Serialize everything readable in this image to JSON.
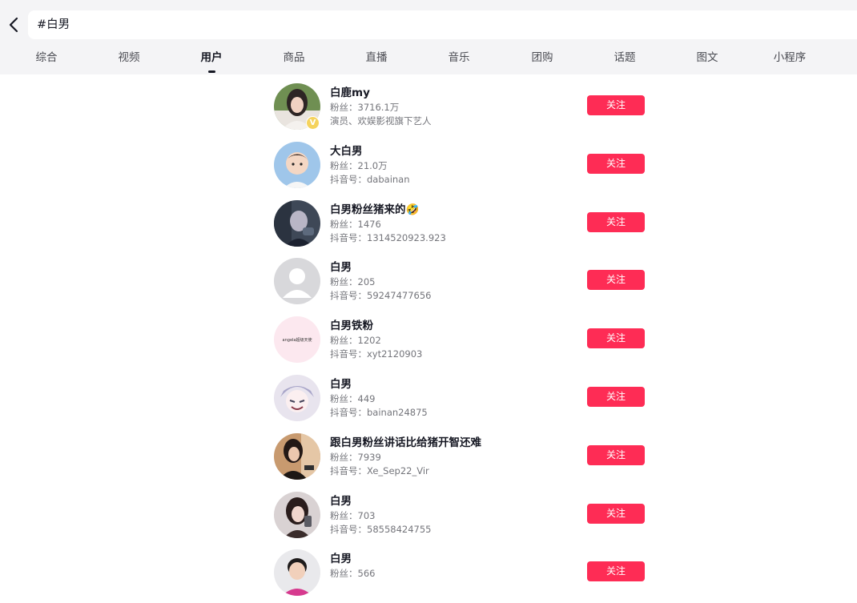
{
  "search": {
    "query": "#白男"
  },
  "tabs": [
    {
      "label": "综合"
    },
    {
      "label": "视频"
    },
    {
      "label": "用户"
    },
    {
      "label": "商品"
    },
    {
      "label": "直播"
    },
    {
      "label": "音乐"
    },
    {
      "label": "团购"
    },
    {
      "label": "话题"
    },
    {
      "label": "图文"
    },
    {
      "label": "小程序"
    }
  ],
  "active_tab": "用户",
  "follow_label": "关注",
  "users": [
    {
      "nickname": "白鹿my",
      "fans": "粉丝：3716.1万",
      "detail": "演员、欢娱影视旗下艺人",
      "verified": true,
      "avatar": "photo-portrait-woman"
    },
    {
      "nickname": "大白男",
      "fans": "粉丝：21.0万",
      "detail": "抖音号：dabainan",
      "avatar": "cartoon-child"
    },
    {
      "nickname": "白男粉丝猪来的🤣",
      "fans": "粉丝：1476",
      "detail": "抖音号：1314520923.923",
      "avatar": "photo-dark-portrait"
    },
    {
      "nickname": "白男",
      "fans": "粉丝：205",
      "detail": "抖音号：59247477656",
      "avatar": "default-gray"
    },
    {
      "nickname": "白男铁粉",
      "fans": "粉丝：1202",
      "detail": "抖音号：xyt2120903",
      "avatar": "pink-text",
      "avatar_text": "angela超级天使"
    },
    {
      "nickname": "白男",
      "fans": "粉丝：449",
      "detail": "抖音号：bainan24875",
      "avatar": "anime-character"
    },
    {
      "nickname": "跟白男粉丝讲话比给猪开智还难",
      "fans": "粉丝：7939",
      "detail": "抖音号：Xe_Sep22_Vir",
      "avatar": "photo-woman-dark-hair"
    },
    {
      "nickname": "白男",
      "fans": "粉丝：703",
      "detail": "抖音号：58558424755",
      "avatar": "photo-woman-selfie"
    },
    {
      "nickname": "白男",
      "fans": "粉丝：566",
      "detail": "",
      "avatar": "photo-man-portrait"
    }
  ]
}
